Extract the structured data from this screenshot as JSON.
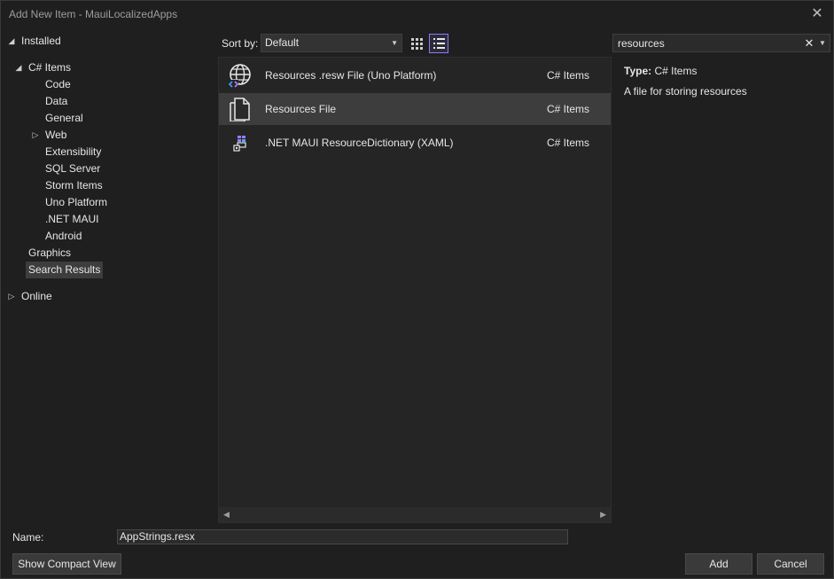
{
  "window": {
    "title": "Add New Item - MauiLocalizedApps"
  },
  "tree": {
    "installed": "Installed",
    "csharp_items": "C# Items",
    "children": [
      "Code",
      "Data",
      "General",
      "Web",
      "Extensibility",
      "SQL Server",
      "Storm Items",
      "Uno Platform",
      ".NET MAUI",
      "Android"
    ],
    "graphics": "Graphics",
    "search_results": "Search Results",
    "online": "Online"
  },
  "toolbar": {
    "sort_label": "Sort by:",
    "sort_value": "Default"
  },
  "search": {
    "value": "resources"
  },
  "items": [
    {
      "name": "Resources .resw File (Uno Platform)",
      "category": "C# Items",
      "icon": "globe-code-icon"
    },
    {
      "name": "Resources File",
      "category": "C# Items",
      "icon": "resource-file-icon"
    },
    {
      "name": ".NET MAUI ResourceDictionary (XAML)",
      "category": "C# Items",
      "icon": "xaml-resource-icon"
    }
  ],
  "details": {
    "type_label": "Type:",
    "type_value": "C# Items",
    "description": "A file for storing resources"
  },
  "footer": {
    "name_label": "Name:",
    "name_value": "AppStrings.resx",
    "compact_label": "Show Compact View",
    "add_label": "Add",
    "cancel_label": "Cancel"
  }
}
